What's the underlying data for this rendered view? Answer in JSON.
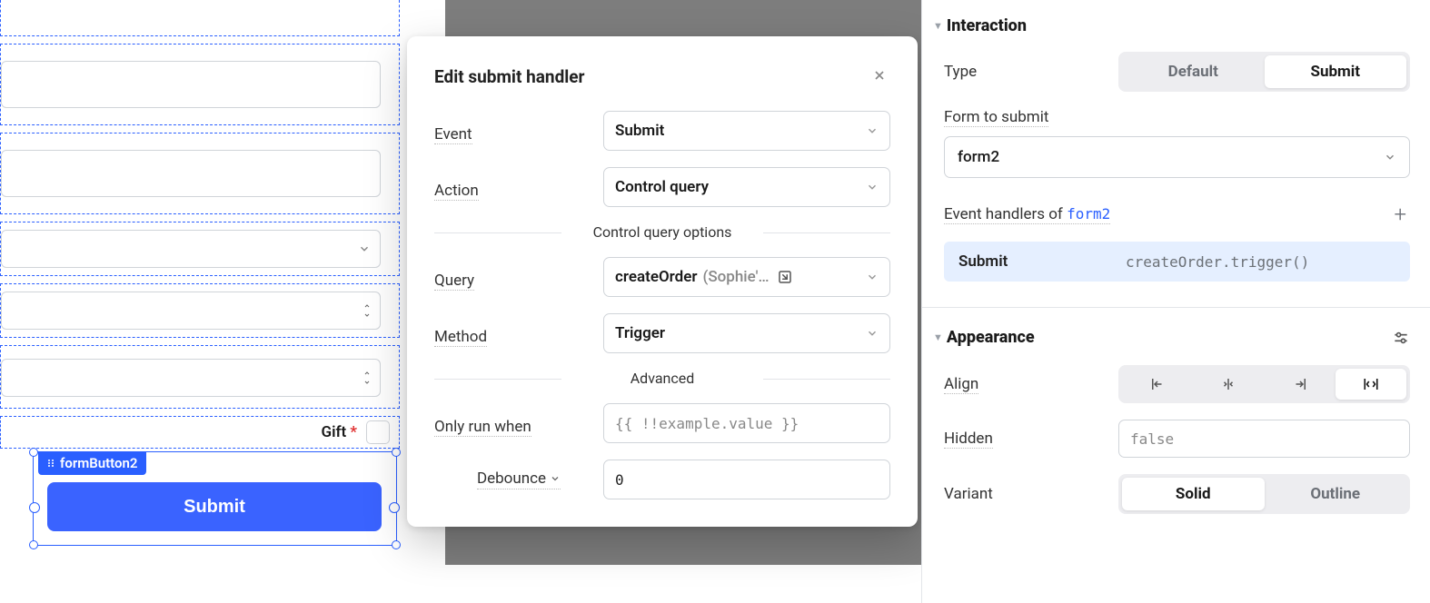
{
  "canvas": {
    "gift_label": "Gift",
    "required_marker": "*",
    "selection_tag": "formButton2",
    "submit_label": "Submit"
  },
  "popover": {
    "title": "Edit submit handler",
    "rows": {
      "event": {
        "label": "Event",
        "value": "Submit"
      },
      "action": {
        "label": "Action",
        "value": "Control query"
      },
      "section1": "Control query options",
      "query": {
        "label": "Query",
        "value": "createOrder",
        "secondary": "(Sophie'…"
      },
      "method": {
        "label": "Method",
        "value": "Trigger"
      },
      "section2": "Advanced",
      "only_run_when": {
        "label": "Only run when",
        "placeholder": "{{ !!example.value }}"
      },
      "debounce": {
        "label": "Debounce",
        "value": "0"
      }
    }
  },
  "inspector": {
    "interaction": {
      "header": "Interaction",
      "type_label": "Type",
      "type_options": [
        "Default",
        "Submit"
      ],
      "type_selected": "Submit",
      "form_label": "Form to submit",
      "form_value": "form2",
      "handlers_label_prefix": "Event handlers of",
      "handlers_link": "form2",
      "handler_row": {
        "event": "Submit",
        "code": "createOrder.trigger()"
      }
    },
    "appearance": {
      "header": "Appearance",
      "align_label": "Align",
      "hidden_label": "Hidden",
      "hidden_value": "false",
      "variant_label": "Variant",
      "variant_options": [
        "Solid",
        "Outline"
      ],
      "variant_selected": "Solid"
    }
  }
}
